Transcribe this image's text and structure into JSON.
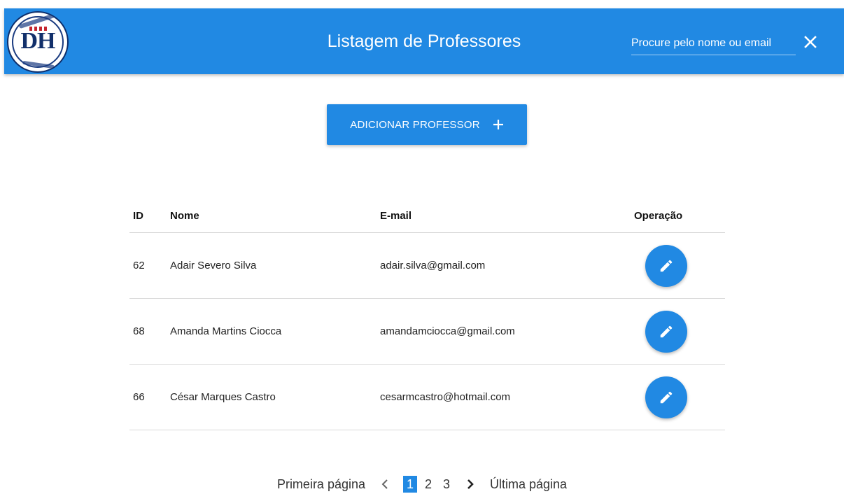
{
  "header": {
    "logo_letters": "DH",
    "title": "Listagem de Professores",
    "search_placeholder": "Procure pelo nome ou email",
    "close_icon": "close-icon"
  },
  "actions": {
    "add_label": "ADICIONAR PROFESSOR",
    "add_icon": "plus-icon"
  },
  "table": {
    "columns": [
      "ID",
      "Nome",
      "E-mail",
      "Operação"
    ],
    "rows": [
      {
        "id": "62",
        "nome": "Adair Severo Silva",
        "email": "adair.silva@gmail.com"
      },
      {
        "id": "68",
        "nome": "Amanda Martins Ciocca",
        "email": "amandamciocca@gmail.com"
      },
      {
        "id": "66",
        "nome": "César Marques Castro",
        "email": "cesarmcastro@hotmail.com"
      }
    ],
    "edit_icon": "pencil-icon"
  },
  "pagination": {
    "first": "Primeira página",
    "last": "Última página",
    "pages": [
      "1",
      "2",
      "3"
    ],
    "current": "1"
  },
  "colors": {
    "primary": "#2189e3",
    "text": "#222222",
    "divider": "#d8d8d8"
  }
}
